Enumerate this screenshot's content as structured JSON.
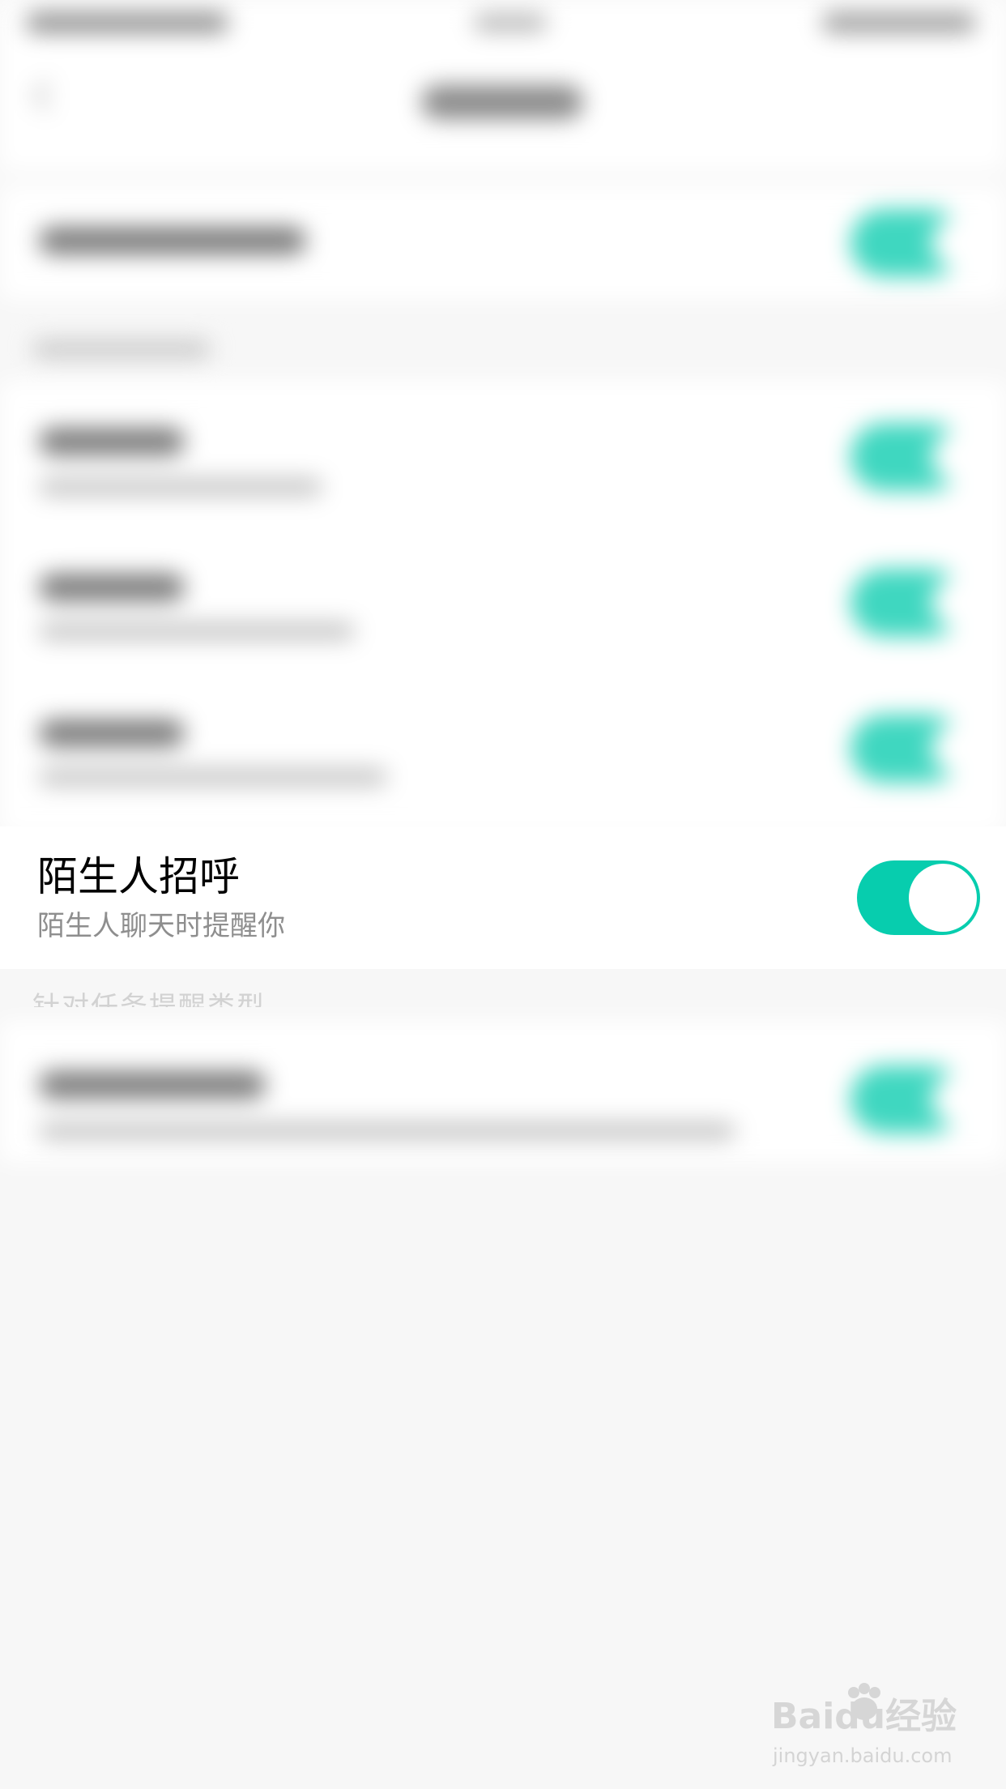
{
  "row": {
    "title": "陌生人招呼",
    "subtitle": "陌生人聊天时提醒你",
    "toggle_on": true
  },
  "ghost_section_label": "针对任务提醒类型",
  "watermark": {
    "brand": "Baidu经验",
    "url": "jingyan.baidu.com"
  },
  "colors": {
    "accent": "#07cdae",
    "background": "#f7f7f7"
  }
}
